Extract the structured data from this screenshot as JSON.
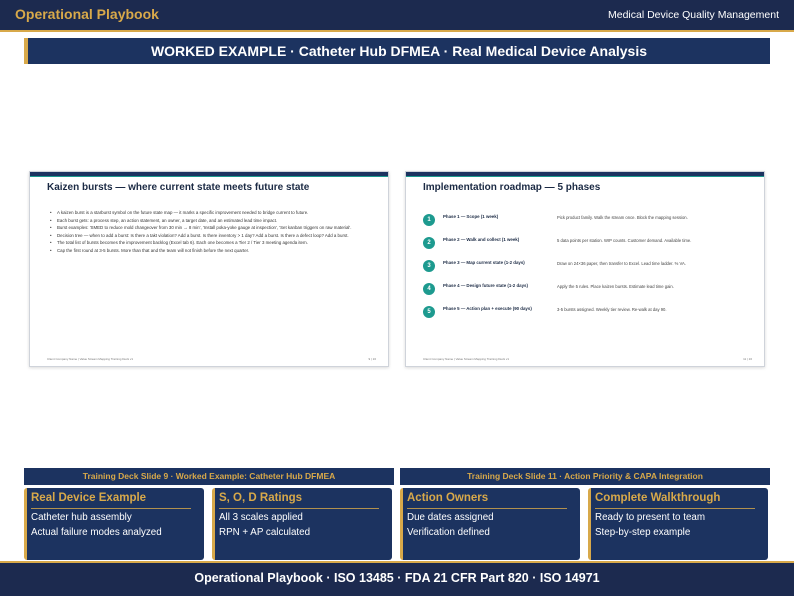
{
  "header": {
    "brand": "Operational Playbook",
    "subtitle": "Medical Device Quality Management"
  },
  "banner": {
    "title": "WORKED EXAMPLE  ·  Catheter Hub DFMEA  ·  Real Medical Device Analysis"
  },
  "slide_left": {
    "title": "Kaizen bursts — where current state meets future state",
    "bullets": [
      "A kaizen burst is a starburst symbol on the future state map — it marks a specific improvement needed to bridge current to future.",
      "Each burst gets: a process step, an action statement, an owner, a target date, and an estimated lead time impact.",
      "Burst examples: 'SMED to reduce mold changeover from 30 min → 8 min', 'Install poka-yoke gauge at inspection', 'Set kanban triggers on raw material'.",
      "Decision tree — when to add a burst: Is there a takt violation? Add a burst. Is there inventory > 1 day? Add a burst. Is there a defect loop? Add a burst.",
      "The total list of bursts becomes the improvement backlog (Excel tab 6). Each one becomes a Tier 2 / Tier 3 meeting agenda item.",
      "Cap the first round at 3-5 bursts. More than that and the team will not finish before the next quarter."
    ],
    "footer": "Client Company Name  |  Value Stream Mapping Training Deck v1",
    "page": "9 | 16"
  },
  "slide_right": {
    "title": "Implementation roadmap — 5 phases",
    "phases": [
      {
        "num": "1",
        "title": "Phase 1 — Scope (1 week)",
        "desc": "Pick product family. Walk the stream once. Block the mapping session."
      },
      {
        "num": "2",
        "title": "Phase 2 — Walk and collect (1 week)",
        "desc": "5 data points per station. WIP counts. Customer demand. Available time."
      },
      {
        "num": "3",
        "title": "Phase 3 — Map current state (1-2 days)",
        "desc": "Draw on 24×36 paper, then transfer to Excel. Lead time ladder. % VA."
      },
      {
        "num": "4",
        "title": "Phase 4 — Design future state (1-2 days)",
        "desc": "Apply the 5 rules. Place kaizen bursts. Estimate lead time gain."
      },
      {
        "num": "5",
        "title": "Phase 5 — Action plan + execute (90 days)",
        "desc": "3-5 bursts assigned. Weekly tier review. Re-walk at day 90."
      }
    ],
    "footer": "Client Company Name  |  Value Stream Mapping Training Deck v1",
    "page": "11 | 16"
  },
  "captions": {
    "left": "Training Deck Slide 9 · Worked Example: Catheter Hub DFMEA",
    "right": "Training Deck Slide 11 · Action Priority & CAPA Integration"
  },
  "cards": [
    {
      "title": "Real Device Example",
      "line1": "Catheter hub assembly",
      "line2": "Actual failure modes analyzed"
    },
    {
      "title": "S, O, D Ratings",
      "line1": "All 3 scales applied",
      "line2": "RPN + AP calculated"
    },
    {
      "title": "Action Owners",
      "line1": "Due dates assigned",
      "line2": "Verification defined"
    },
    {
      "title": "Complete Walkthrough",
      "line1": "Ready to present to team",
      "line2": "Step-by-step example"
    }
  ],
  "footer": {
    "text": "Operational Playbook  ·  ISO 13485  ·  FDA 21 CFR Part 820  ·  ISO 14971"
  },
  "colors": {
    "navy": "#1c2a4f",
    "banner_navy": "#1c3360",
    "gold": "#d8a94a",
    "teal": "#1d9a8f"
  }
}
